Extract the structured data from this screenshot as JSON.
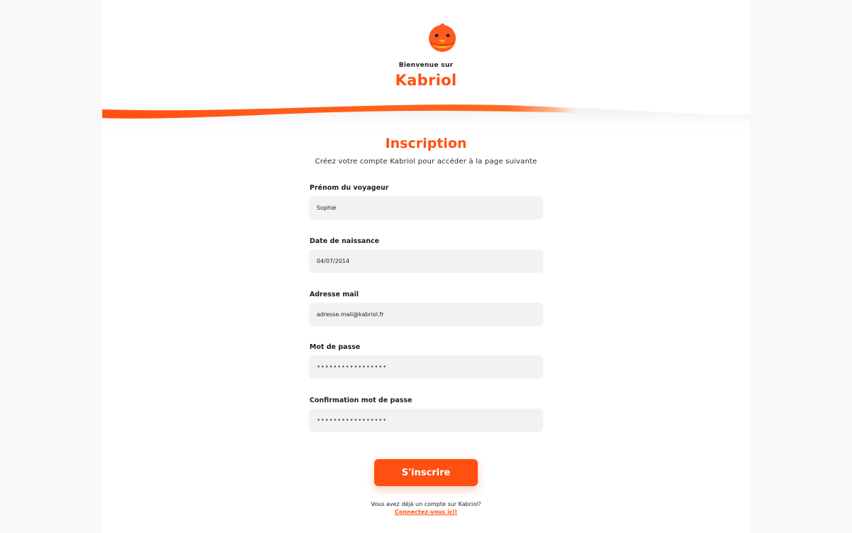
{
  "header": {
    "welcome": "Bienvenue sur",
    "brand": "Kabriol",
    "logo_icon": "bird-mascot-icon"
  },
  "form": {
    "title": "Inscription",
    "subtitle": "Créez votre compte Kabriol pour accéder à la page suivante",
    "fields": [
      {
        "label": "Prénom du voyageur",
        "value": "Sophie",
        "type": "text"
      },
      {
        "label": "Date de naissance",
        "value": "04/07/2014",
        "type": "text"
      },
      {
        "label": "Adresse mail",
        "value": "adresse.mail@kabriol.fr",
        "type": "email"
      },
      {
        "label": "Mot de passe",
        "value": "•••••••••••••••••",
        "type": "password"
      },
      {
        "label": "Confirmation mot de passe",
        "value": "•••••••••••••••••",
        "type": "password"
      }
    ],
    "submit_label": "S'inscrire"
  },
  "footer": {
    "text": "Vous avez déjà un compte sur Kabriol?",
    "link": "Connectez-vous ici!"
  },
  "colors": {
    "accent": "#ff5011",
    "input_bg": "#f2f2f2",
    "text": "#1c1c2b"
  }
}
